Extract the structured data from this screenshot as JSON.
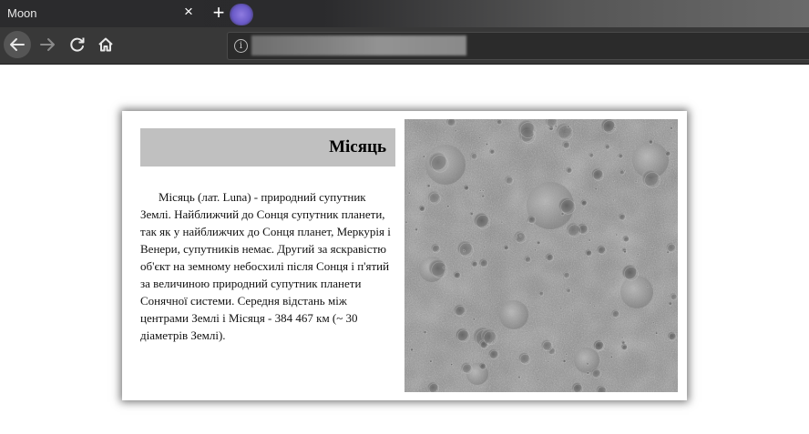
{
  "browser": {
    "tab_title": "Moon",
    "tab_close": "×",
    "new_tab": "+"
  },
  "icons": {
    "back": "back-arrow-icon",
    "forward": "forward-arrow-icon",
    "reload": "reload-icon",
    "home": "home-icon",
    "info": "info-icon",
    "close": "close-icon",
    "new_tab": "plus-icon"
  },
  "article": {
    "heading": "Місяць",
    "body": "Місяць (лат. Luna) - природний супутник Землі. Найближчий до Сонця супутник планети, так як у найближчих до Сонця планет, Меркурія і Венери, супутників немає. Другий за яскравістю об'єкт на земному небосхилі після Сонця і п'ятий за величиною природний супутник планети Сонячної системи. Середня відстань між центрами Землі і Місяця - 384 467 км (~ 30 діаметрів Землі).",
    "image_alt": "lunar surface"
  },
  "colors": {
    "heading_bg": "#c0c0c0",
    "chrome_bg": "#383838",
    "tab_bg": "#2b2b2d"
  }
}
